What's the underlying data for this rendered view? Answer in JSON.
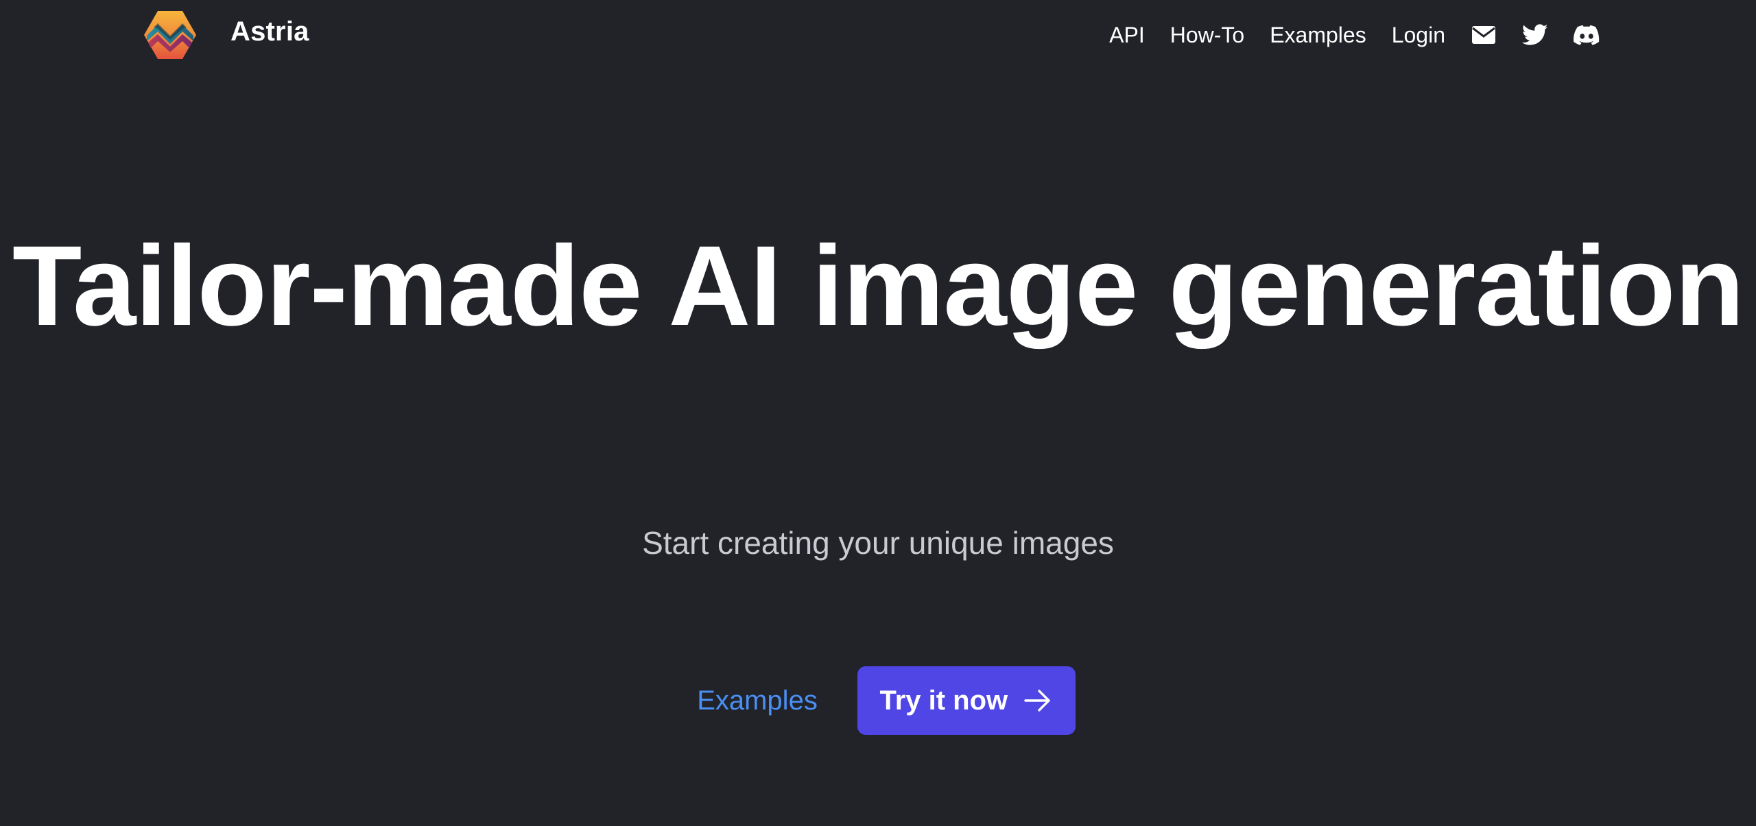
{
  "header": {
    "brand_name": "Astria",
    "logo_icon": "astria-hexagon-logo",
    "nav": {
      "api": "API",
      "how_to": "How-To",
      "examples": "Examples",
      "login": "Login"
    },
    "icons": [
      "envelope-icon",
      "twitter-icon",
      "discord-icon"
    ]
  },
  "hero": {
    "title": "Tailor-made AI image generation",
    "subtitle": "Start creating your unique images",
    "examples_label": "Examples",
    "cta_label": "Try it now"
  },
  "colors": {
    "background": "#212329",
    "accent": "#4f46e5",
    "link": "#4a8ff2",
    "subtitle": "#c9cbd0"
  }
}
